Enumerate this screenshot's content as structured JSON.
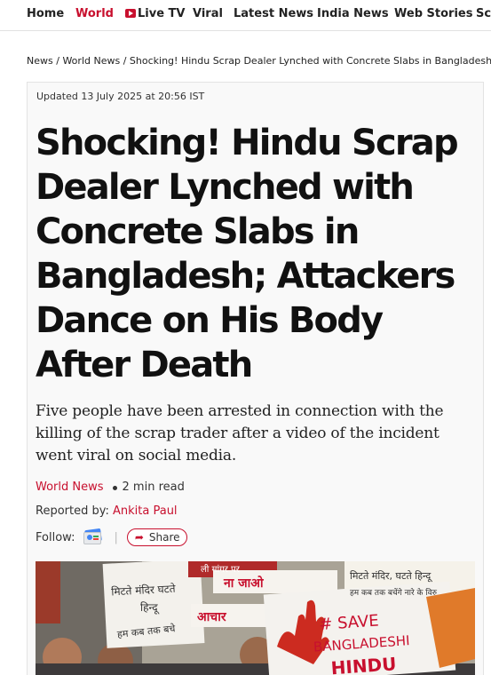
{
  "nav": {
    "items": [
      {
        "label": "Home"
      },
      {
        "label": "World"
      },
      {
        "label": "Live TV",
        "icon": "live-tv-icon"
      },
      {
        "label": "Viral"
      },
      {
        "label": "Latest News"
      },
      {
        "label": "India News"
      },
      {
        "label": "Web Stories"
      },
      {
        "label": "Sci"
      }
    ],
    "active": "World"
  },
  "breadcrumb": {
    "items": [
      "News",
      "World News",
      "Shocking! Hindu Scrap Dealer Lynched with Concrete Slabs in Bangladesh; Atta"
    ],
    "separator": "/"
  },
  "article": {
    "updated": "Updated 13 July 2025 at 20:56 IST",
    "headline": "Shocking! Hindu Scrap Dealer Lynched with Concrete Slabs in Bangladesh; Attackers Dance on His Body After Death",
    "summary": "Five people have been arrested in connection with the killing of the scrap trader after a video of the incident went viral on social media.",
    "category": "World News",
    "read_time": "2 min read",
    "reported_by_label": "Reported by:",
    "author": "Ankita Paul",
    "follow_label": "Follow:",
    "follow_icon": "google-news-icon",
    "share_label": "Share",
    "share_icon": "share-arrow-icon"
  },
  "hero_image": {
    "signs": [
      "मिटते मंदिर, घटते हिन्दू",
      "हम कब तक बचेंगे नारे के विरु",
      "# SAVE",
      "BANGLADESHI",
      "HINDU",
      "ना जाओ",
      "आचार",
      "मिटते मंदिर घटते",
      "हिन्दू",
      "हम कब तक बचे",
      "ली मांगर पर"
    ]
  },
  "colors": {
    "accent": "#c8102e",
    "text": "#111111",
    "card_bg": "#f9f9f9"
  }
}
